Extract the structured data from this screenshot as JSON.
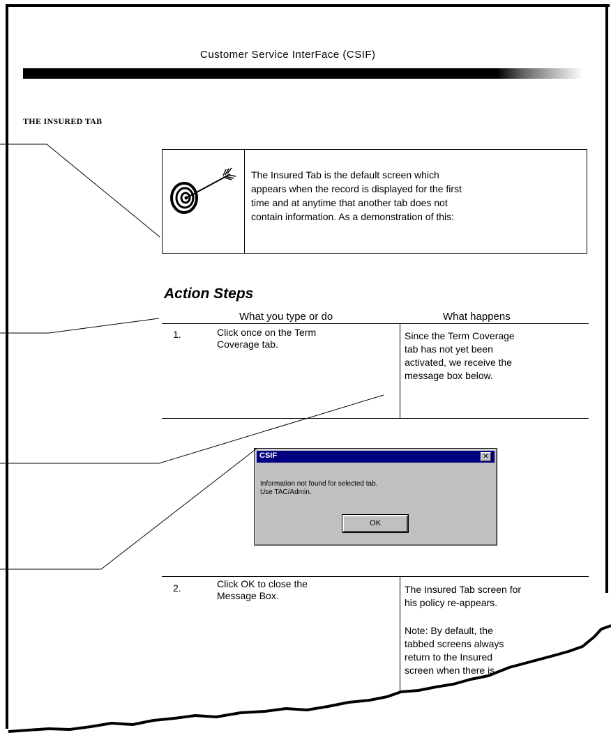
{
  "header": {
    "title": "Customer Service InterFace (CSIF)"
  },
  "section": {
    "heading": "THE INSURED TAB"
  },
  "callout": {
    "icon": "target-icon",
    "lines": [
      "The Insured Tab is the default screen which",
      "appears when the record is displayed for the first",
      "time and at anytime that another tab does not",
      "contain information. As a demonstration of this:"
    ]
  },
  "action_steps": {
    "title": "Action Steps",
    "col_do": "What you type or do",
    "col_happens": "What happens",
    "steps": [
      {
        "num": "1.",
        "do_lines": [
          "Click once on the Term",
          "Coverage tab."
        ],
        "happens_lines": [
          "Since the Term Coverage",
          "tab has not yet been",
          "activated, we receive the",
          "message box below."
        ]
      },
      {
        "num": "2.",
        "do_lines": [
          "Click OK to close the",
          "Message Box."
        ],
        "happens_lines": [
          "The Insured Tab screen for",
          "his policy re-appears."
        ],
        "note_lines": [
          "Note: By default, the",
          "tabbed screens always",
          "return to the Insured",
          "screen when there is"
        ]
      }
    ]
  },
  "dialog": {
    "title": "CSIF",
    "close_glyph": "✕",
    "message_line1": "Information not found for selected tab.",
    "message_line2": "Use TAC/Admin.",
    "ok_label": "OK"
  }
}
